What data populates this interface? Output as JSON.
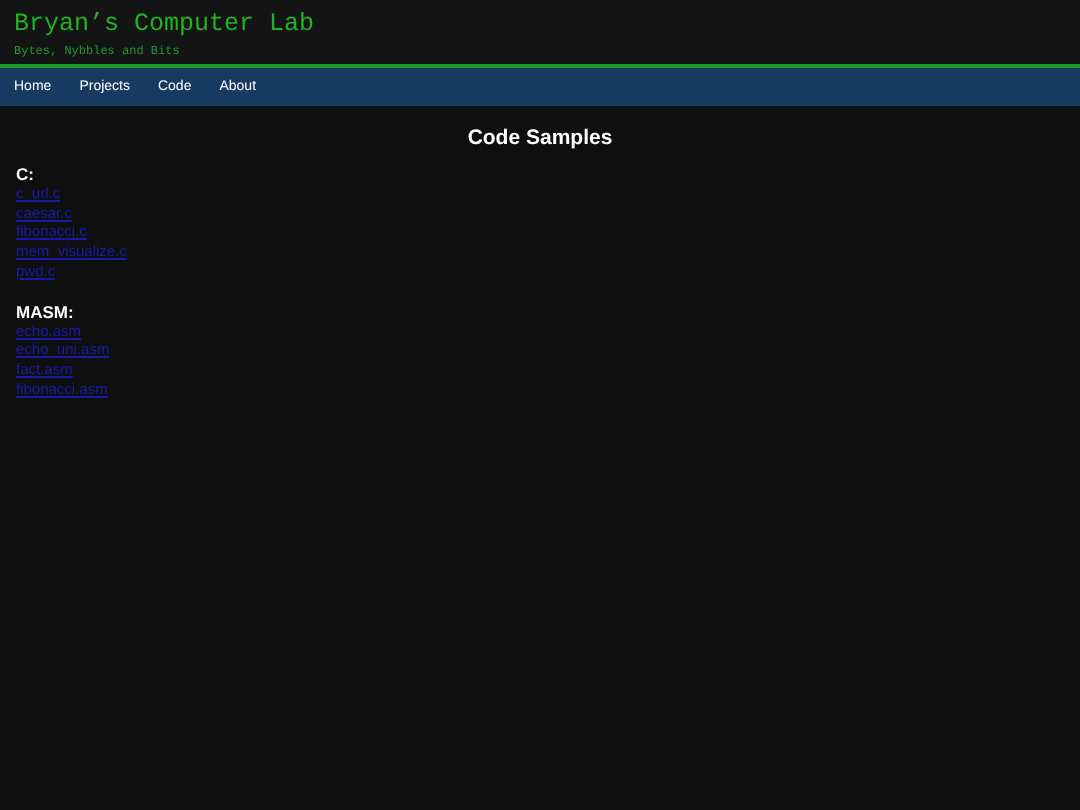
{
  "header": {
    "title": "Bryan’s Computer Lab",
    "subtitle": "Bytes, Nybbles and Bits"
  },
  "nav": [
    "Home",
    "Projects",
    "Code",
    "About"
  ],
  "page_title": "Code Samples",
  "sections": [
    {
      "heading": "C:",
      "files": [
        "c_url.c",
        "caesar.c",
        "fibonacci.c",
        "mem_visualize.c",
        "pwd.c"
      ]
    },
    {
      "heading": "MASM:",
      "files": [
        "echo.asm",
        "echo_uni.asm",
        "fact.asm",
        "fibonacci.asm"
      ]
    }
  ]
}
